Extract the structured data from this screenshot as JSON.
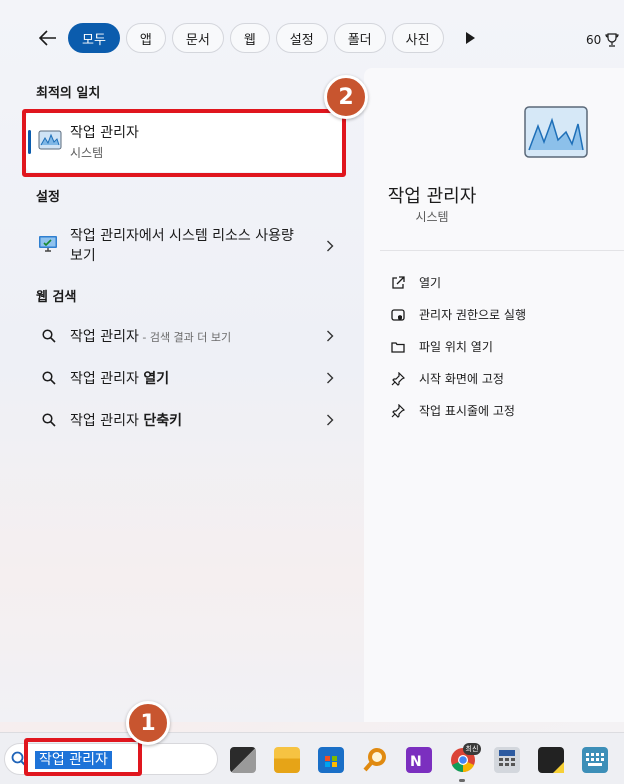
{
  "filters": {
    "items": [
      {
        "label": "모두",
        "active": true
      },
      {
        "label": "앱",
        "active": false
      },
      {
        "label": "문서",
        "active": false
      },
      {
        "label": "웹",
        "active": false
      },
      {
        "label": "설정",
        "active": false
      },
      {
        "label": "폴더",
        "active": false
      },
      {
        "label": "사진",
        "active": false
      }
    ],
    "points": "60"
  },
  "best_match": {
    "section": "최적의 일치",
    "title": "작업 관리자",
    "subtitle": "시스템"
  },
  "settings": {
    "section": "설정",
    "item": "작업 관리자에서 시스템 리소스 사용량 보기"
  },
  "web_search": {
    "section": "웹 검색",
    "items": [
      {
        "query": "작업 관리자",
        "suffix": " - 검색 결과 더 보기",
        "bold": ""
      },
      {
        "query": "작업 관리자 ",
        "suffix": "",
        "bold": "열기"
      },
      {
        "query": "작업 관리자 ",
        "suffix": "",
        "bold": "단축키"
      }
    ]
  },
  "detail": {
    "title": "작업 관리자",
    "subtitle": "시스템",
    "actions": [
      {
        "label": "열기",
        "icon": "open-external-icon"
      },
      {
        "label": "관리자 권한으로 실행",
        "icon": "shield-admin-icon"
      },
      {
        "label": "파일 위치 열기",
        "icon": "folder-icon"
      },
      {
        "label": "시작 화면에 고정",
        "icon": "pin-icon"
      },
      {
        "label": "작업 표시줄에 고정",
        "icon": "pin-icon"
      }
    ]
  },
  "taskbar": {
    "search_query": "작업 관리자",
    "chrome_badge": "최신"
  },
  "annotations": {
    "badge1": "1",
    "badge2": "2"
  },
  "colors": {
    "accent": "#0b5cad",
    "highlight_red": "#e0161e",
    "badge_orange": "#c8552f"
  }
}
